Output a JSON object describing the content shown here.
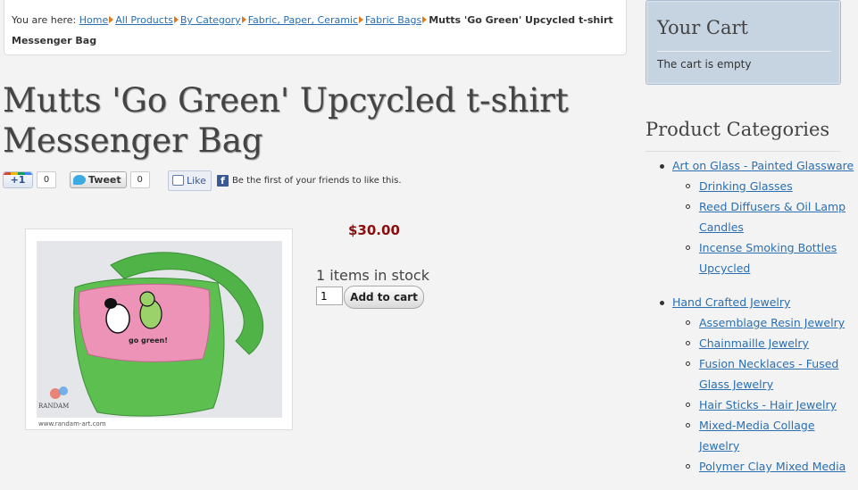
{
  "breadcrumb": {
    "prefix": "You are here:",
    "links": [
      "Home",
      "All Products",
      "By Category",
      "Fabric, Paper, Ceramic",
      "Fabric Bags"
    ],
    "current": "Mutts 'Go Green' Upcycled t-shirt Messenger Bag"
  },
  "product": {
    "title": "Mutts 'Go Green' Upcycled t-shirt Messenger Bag",
    "price": "$30.00",
    "stock": "1 items in stock",
    "quantity": "1",
    "add_to_cart": "Add to cart",
    "image": {
      "shirt_text": "go green!",
      "watermark_brand": "RANDAM",
      "watermark_url": "www.randam-art.com"
    }
  },
  "social": {
    "gplus_label": "+1",
    "gplus_count": "0",
    "tweet_label": "Tweet",
    "tweet_count": "0",
    "fb_like_label": "Like",
    "fb_text": "Be the first of your friends to like this."
  },
  "cart": {
    "title": "Your Cart",
    "status": "The cart is empty"
  },
  "categories": {
    "title": "Product Categories",
    "groups": [
      {
        "label": "Art on Glass - Painted Glassware",
        "items": [
          "Drinking Glasses",
          "Reed Diffusers & Oil Lamp Candles",
          "Incense Smoking Bottles Upcycled"
        ]
      },
      {
        "label": "Hand Crafted Jewelry",
        "items": [
          "Assemblage Resin Jewelry",
          "Chainmaille Jewelry",
          "Fusion Necklaces - Fused Glass Jewelry",
          "Hair Sticks - Hair Jewelry",
          "Mixed-Media Collage Jewelry",
          "Polymer Clay Mixed Media"
        ]
      }
    ]
  },
  "colors": {
    "link": "#2a6fb1",
    "price": "#8b0d0d",
    "cart_bg": "#c6d4e2",
    "breadcrumb_arrow": "#e07a1f"
  }
}
